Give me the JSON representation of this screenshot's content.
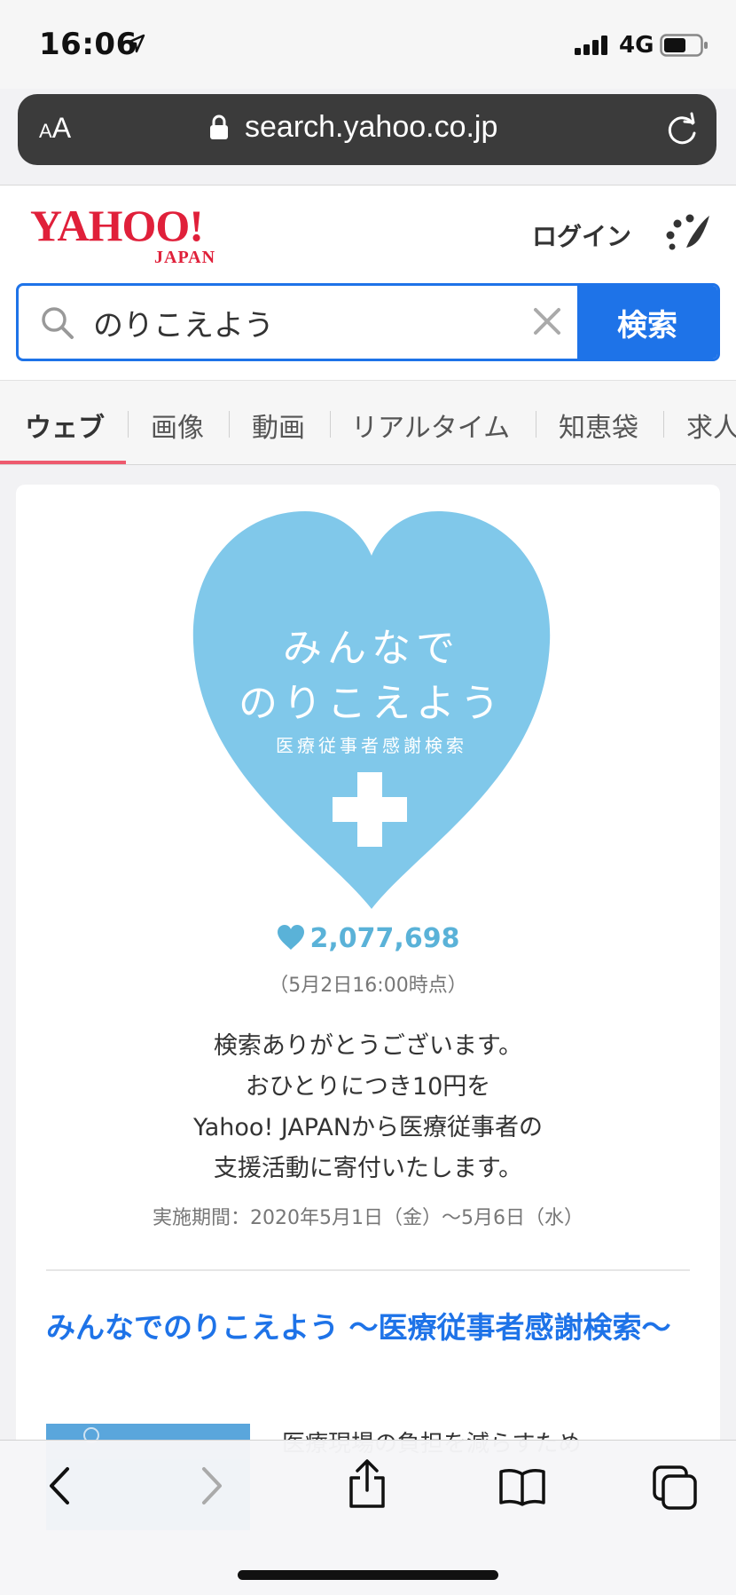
{
  "status_bar": {
    "time": "16:06",
    "network": "4G"
  },
  "browser": {
    "text_size_small": "A",
    "text_size_big": "A",
    "url": "search.yahoo.co.jp"
  },
  "header": {
    "logo_main": "YAHOO!",
    "logo_sub": "JAPAN",
    "login_label": "ログイン",
    "search_value": "のりこえよう",
    "search_button_label": "検索"
  },
  "tabs": [
    {
      "label": "ウェブ",
      "active": true
    },
    {
      "label": "画像"
    },
    {
      "label": "動画"
    },
    {
      "label": "リアルタイム"
    },
    {
      "label": "知恵袋"
    },
    {
      "label": "求人"
    }
  ],
  "campaign": {
    "heart_line1": "みんなで",
    "heart_line2": "のりこえよう",
    "heart_line3": "医療従事者感謝検索",
    "count": "2,077,698",
    "count_time": "（5月2日16:00時点）",
    "thanks_lines": [
      "検索ありがとうございます。",
      "おひとりにつき10円を",
      "Yahoo! JAPANから医療従事者の",
      "支援活動に寄付いたします。"
    ],
    "period": "実施期間：2020年5月1日（金）〜5月6日（水）"
  },
  "result": {
    "title": "みんなでのりこえよう 〜医療従事者感謝検索〜",
    "snippet": "医療現場の負担を減らすため"
  },
  "colors": {
    "yahoo_red": "#e0203a",
    "accent_blue": "#1e73e8",
    "heart_blue": "#80c8ea",
    "tab_underline": "#ee5a6e"
  }
}
